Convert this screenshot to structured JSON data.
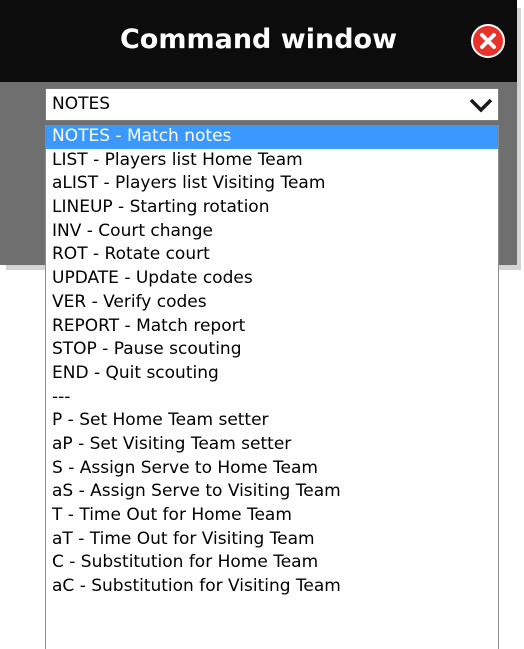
{
  "window": {
    "title": "Command window",
    "close_icon": "close-circle-icon",
    "titlebar_color": "#0c0c0c",
    "body_color": "#6f6f6f",
    "close_color": "#e8332b"
  },
  "command_select": {
    "selected_value": "NOTES",
    "arrow_icon": "chevron-down-icon",
    "highlight_color": "#3b98ff",
    "options": [
      "NOTES - Match notes",
      "LIST - Players list Home Team",
      "aLIST - Players list Visiting Team",
      "LINEUP - Starting rotation",
      "INV - Court change",
      "ROT - Rotate court",
      "UPDATE - Update codes",
      "VER - Verify codes",
      "REPORT - Match report",
      "STOP - Pause scouting",
      "END - Quit scouting",
      "---",
      "P - Set Home Team setter",
      "aP - Set Visiting Team setter",
      "S - Assign Serve to Home Team",
      "aS - Assign Serve to Visiting Team",
      "T - Time Out for Home Team",
      "aT - Time Out for Visiting Team",
      "C - Substitution for Home Team",
      "aC - Substitution for Visiting Team"
    ],
    "highlighted_index": 0
  }
}
